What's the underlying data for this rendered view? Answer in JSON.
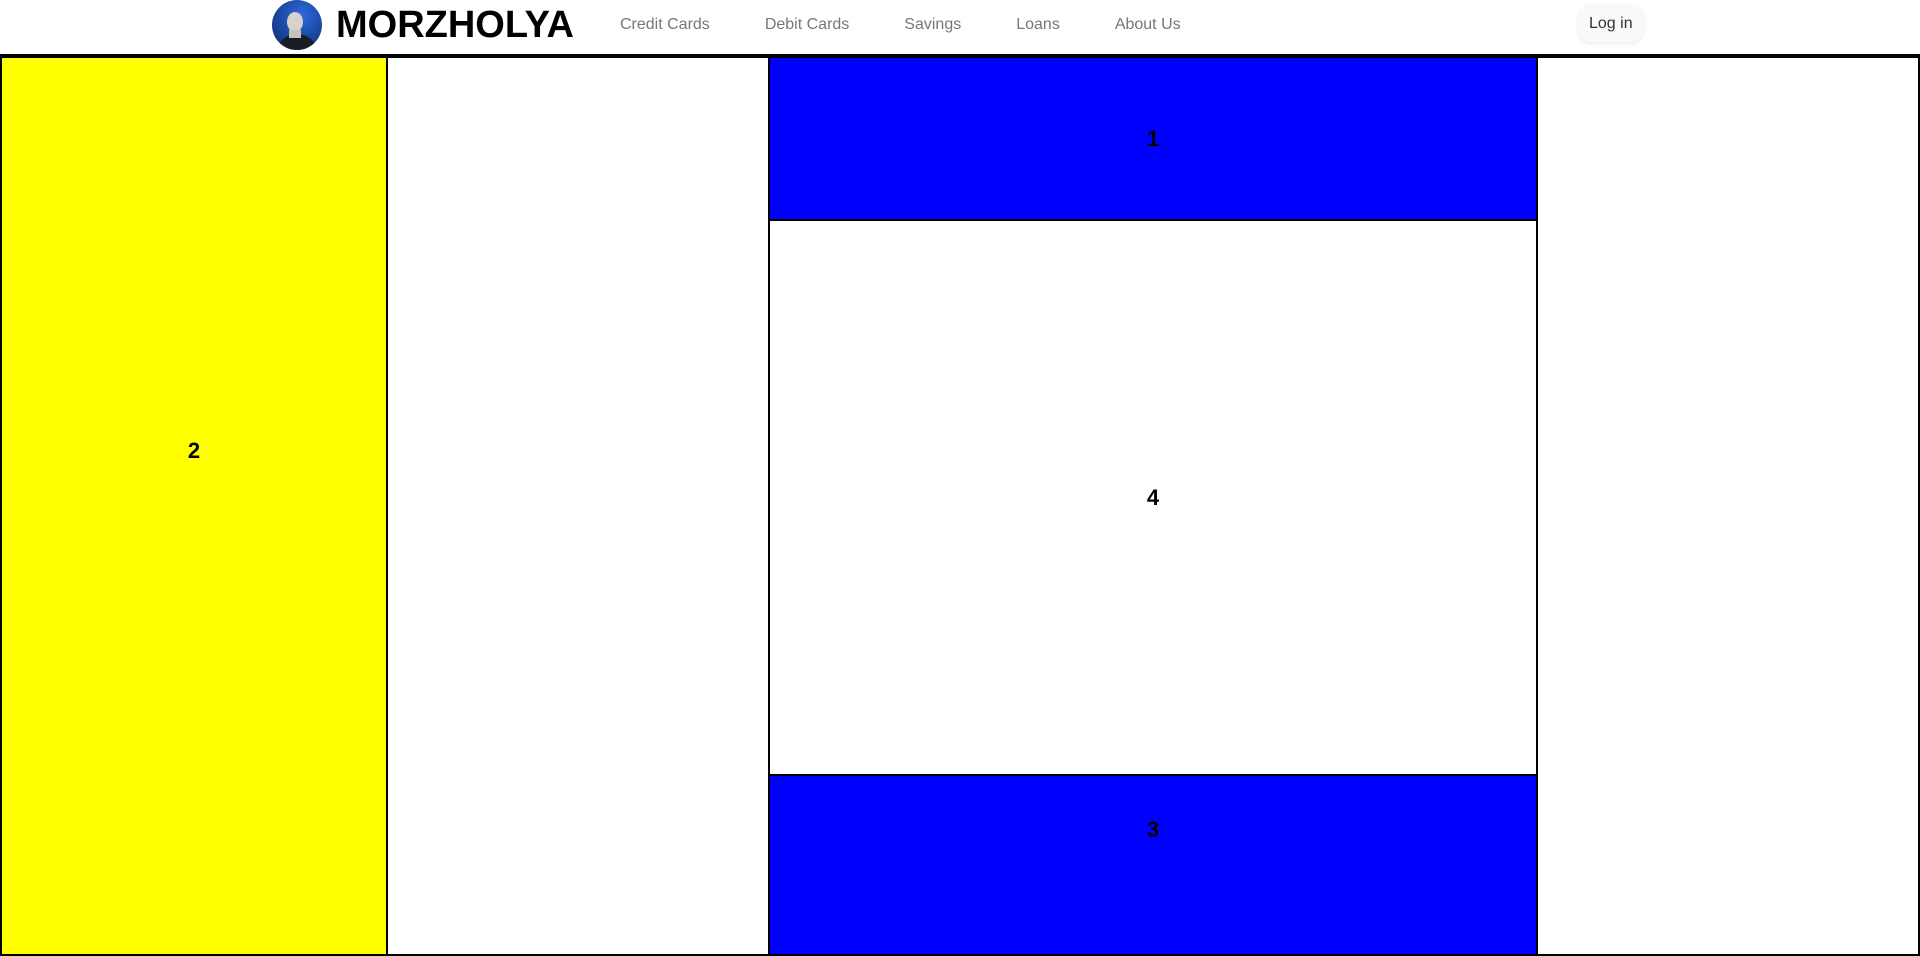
{
  "navbar": {
    "brand_name": "MORZHOLYA",
    "links": [
      "Credit Cards",
      "Debit Cards",
      "Savings",
      "Loans",
      "About Us"
    ],
    "login_label": "Log in"
  },
  "grid": {
    "cells": {
      "top_center": "1",
      "left": "2",
      "bottom_center": "3",
      "middle_center": "4"
    }
  },
  "colors": {
    "yellow": "#ffff00",
    "blue": "#0000ff",
    "border": "#000000",
    "nav_link": "#74777c"
  }
}
